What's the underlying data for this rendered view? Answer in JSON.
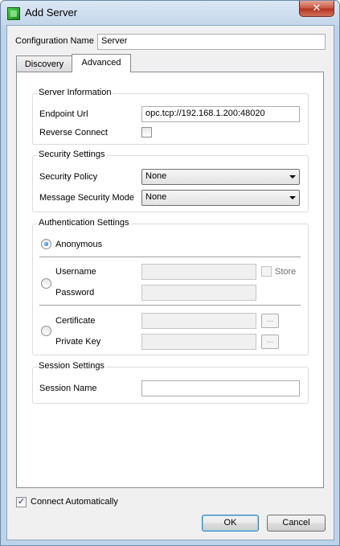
{
  "window": {
    "title": "Add Server",
    "close_glyph": "✕"
  },
  "config": {
    "name_label": "Configuration Name",
    "name_value": "Server"
  },
  "tabs": [
    {
      "label": "Discovery"
    },
    {
      "label": "Advanced"
    }
  ],
  "server_info": {
    "title": "Server Information",
    "endpoint_label": "Endpoint Url",
    "endpoint_value": "opc.tcp://192.168.1.200:48020",
    "reverse_label": "Reverse Connect"
  },
  "security": {
    "title": "Security Settings",
    "policy_label": "Security Policy",
    "policy_value": "None",
    "mode_label": "Message Security Mode",
    "mode_value": "None"
  },
  "auth": {
    "title": "Authentication Settings",
    "anonymous_label": "Anonymous",
    "username_label": "Username",
    "password_label": "Password",
    "store_label": "Store",
    "certificate_label": "Certificate",
    "private_key_label": "Private Key",
    "browse_glyph": "..."
  },
  "session": {
    "title": "Session Settings",
    "name_label": "Session Name"
  },
  "footer": {
    "connect_label": "Connect Automatically",
    "connect_checked": "✓",
    "ok_label": "OK",
    "cancel_label": "Cancel"
  }
}
